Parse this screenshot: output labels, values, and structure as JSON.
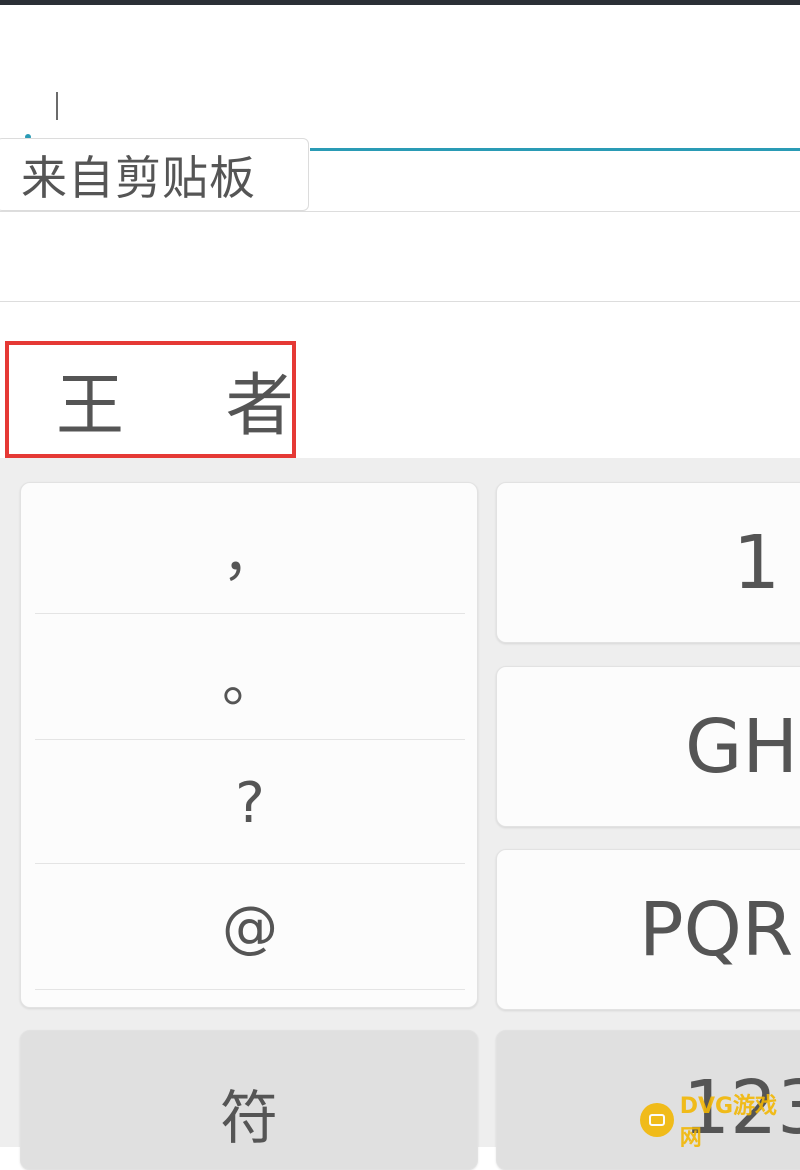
{
  "input": {
    "clipboard_chip_label": "来自剪贴板"
  },
  "candidates": {
    "highlighted_word": "王 者"
  },
  "keyboard": {
    "symbol_keys": [
      "，",
      "。",
      "?",
      "@"
    ],
    "keys": {
      "key_1": "1",
      "key_ghi": "GH",
      "key_pqrs": "PQR",
      "key_symbols": "符",
      "key_123": "123"
    }
  },
  "watermark": {
    "text": "DVG游戏网"
  },
  "colors": {
    "accent": "#2a9bb5",
    "highlight_box": "#e53935",
    "keyboard_bg": "#eeeeee",
    "key_bg": "#fcfcfc",
    "watermark": "#f2b705"
  }
}
